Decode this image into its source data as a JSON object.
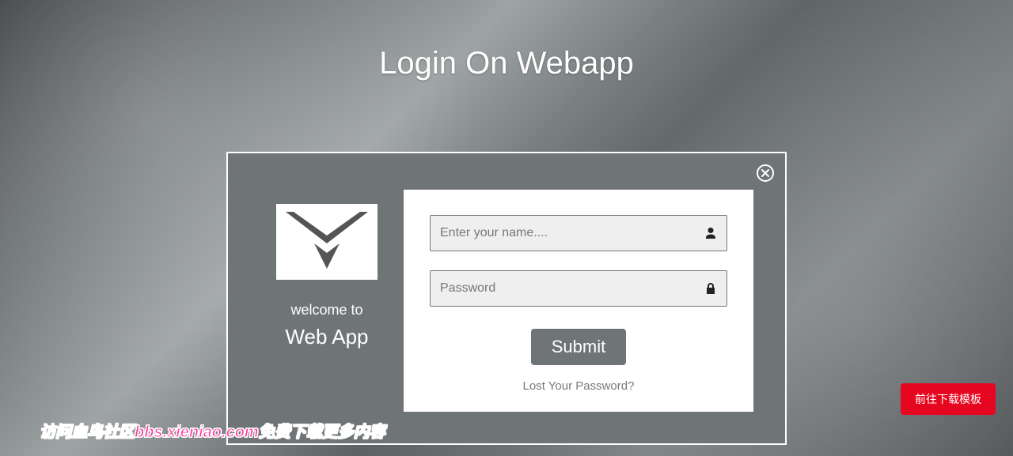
{
  "page": {
    "title": "Login On Webapp"
  },
  "modal": {
    "welcome_small": "welcome to",
    "welcome_big": "Web App",
    "form": {
      "username_placeholder": "Enter your name....",
      "password_placeholder": "Password",
      "submit_label": "Submit",
      "lost_password_label": "Lost Your Password?"
    }
  },
  "footer": {
    "download_button_label": "前往下载模板",
    "watermark_text": "访问血鸟社区bbs.xieniao.com免费下载更多内容"
  }
}
